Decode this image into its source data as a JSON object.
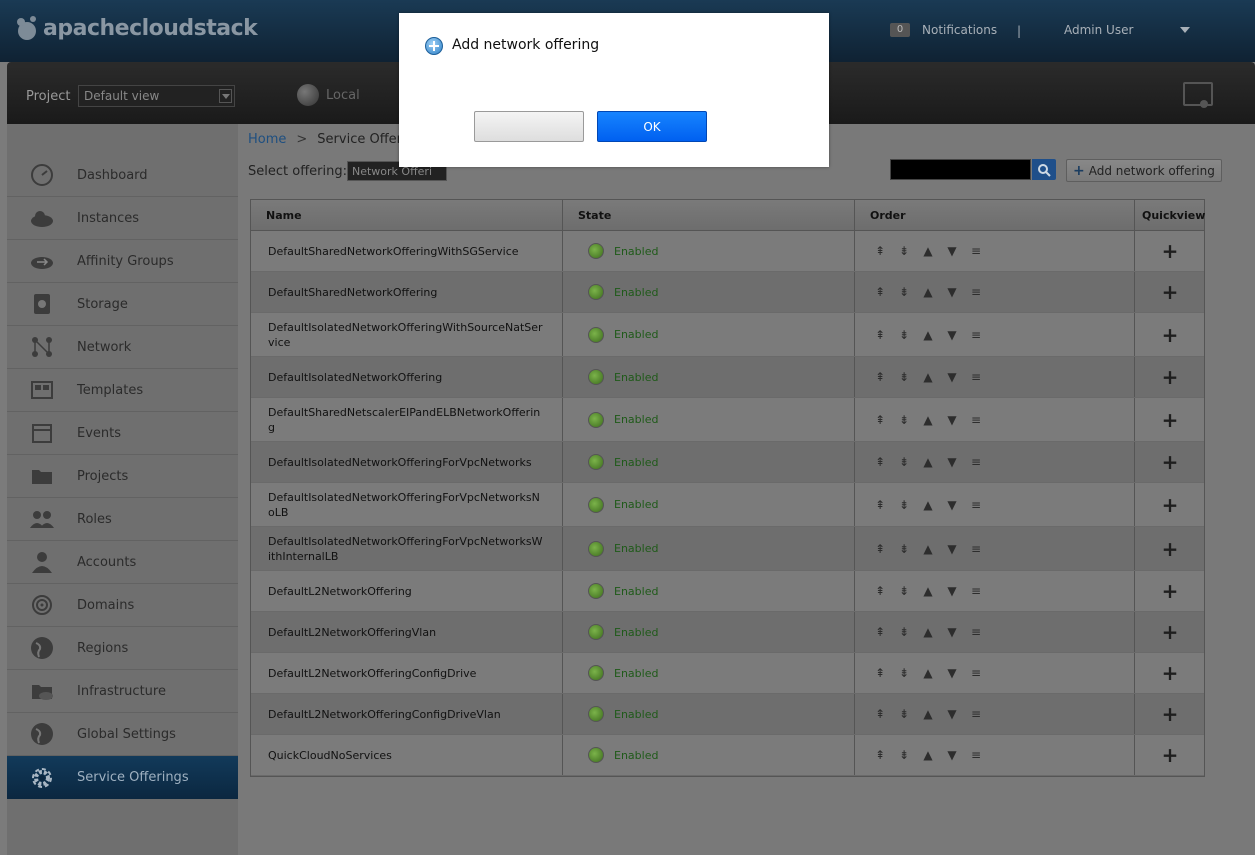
{
  "header": {
    "logo_text": "apachecloudstack",
    "notifications_count": "0",
    "notifications_label": "Notifications",
    "separator": "|",
    "user_name": "Admin User"
  },
  "projectbar": {
    "project_label": "Project",
    "project_value": "Default view",
    "zone_label": "Local"
  },
  "sidebar": {
    "items": [
      {
        "label": "Dashboard",
        "icon": "dashboard-icon"
      },
      {
        "label": "Instances",
        "icon": "cloud-icon"
      },
      {
        "label": "Affinity Groups",
        "icon": "affinity-icon"
      },
      {
        "label": "Storage",
        "icon": "storage-icon"
      },
      {
        "label": "Network",
        "icon": "network-icon"
      },
      {
        "label": "Templates",
        "icon": "templates-icon"
      },
      {
        "label": "Events",
        "icon": "calendar-icon"
      },
      {
        "label": "Projects",
        "icon": "folder-icon"
      },
      {
        "label": "Roles",
        "icon": "roles-icon"
      },
      {
        "label": "Accounts",
        "icon": "user-icon"
      },
      {
        "label": "Domains",
        "icon": "domains-icon"
      },
      {
        "label": "Regions",
        "icon": "globe-icon"
      },
      {
        "label": "Infrastructure",
        "icon": "infrastructure-icon"
      },
      {
        "label": "Global Settings",
        "icon": "globe-settings-icon"
      },
      {
        "label": "Service Offerings",
        "icon": "gear-icon"
      }
    ],
    "active_index": 14
  },
  "breadcrumb": {
    "home": "Home",
    "arrow": ">",
    "current": "Service Offeri"
  },
  "toolbar": {
    "select_label": "Select offering:",
    "select_value": "Network Offeri",
    "add_button_label": "Add network offering",
    "add_button_plus": "+"
  },
  "table": {
    "columns": [
      "Name",
      "State",
      "Order",
      "Quickview"
    ],
    "order_glyphs": [
      "⇞",
      "⇟",
      "▲",
      "▼",
      "≡"
    ],
    "quickview_glyph": "+",
    "rows": [
      {
        "name": "DefaultSharedNetworkOfferingWithSGService",
        "state": "Enabled"
      },
      {
        "name": "DefaultSharedNetworkOffering",
        "state": "Enabled"
      },
      {
        "name": "DefaultIsolatedNetworkOfferingWithSourceNatService",
        "state": "Enabled"
      },
      {
        "name": "DefaultIsolatedNetworkOffering",
        "state": "Enabled"
      },
      {
        "name": "DefaultSharedNetscalerEIPandELBNetworkOffering",
        "state": "Enabled"
      },
      {
        "name": "DefaultIsolatedNetworkOfferingForVpcNetworks",
        "state": "Enabled"
      },
      {
        "name": "DefaultIsolatedNetworkOfferingForVpcNetworksNoLB",
        "state": "Enabled"
      },
      {
        "name": "DefaultIsolatedNetworkOfferingForVpcNetworksWithInternalLB",
        "state": "Enabled"
      },
      {
        "name": "DefaultL2NetworkOffering",
        "state": "Enabled"
      },
      {
        "name": "DefaultL2NetworkOfferingVlan",
        "state": "Enabled"
      },
      {
        "name": "DefaultL2NetworkOfferingConfigDrive",
        "state": "Enabled"
      },
      {
        "name": "DefaultL2NetworkOfferingConfigDriveVlan",
        "state": "Enabled"
      },
      {
        "name": "QuickCloudNoServices",
        "state": "Enabled"
      }
    ]
  },
  "dialog": {
    "title": "Add network offering",
    "cancel_label": "",
    "ok_label": "OK"
  },
  "colors": {
    "header_bg": "#1a3a54",
    "active_nav": "#0b2740",
    "ok_button": "#0a6cff",
    "enabled_text": "#1f5a19"
  }
}
